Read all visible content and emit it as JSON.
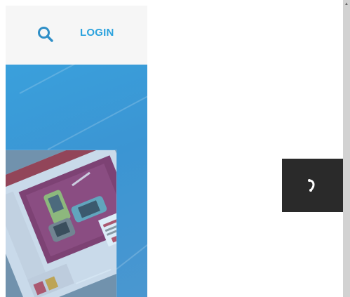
{
  "header": {
    "search_icon": "search-icon",
    "login_label": "LOGIN",
    "accent_color": "#2ba2dd"
  },
  "hero": {
    "background_color": "#3b9bd6",
    "preview_image": "screenshot-of-website-with-handheld-game-consoles"
  },
  "floating_call": {
    "icon": "phone-icon",
    "background_color": "#2a2a2a"
  }
}
